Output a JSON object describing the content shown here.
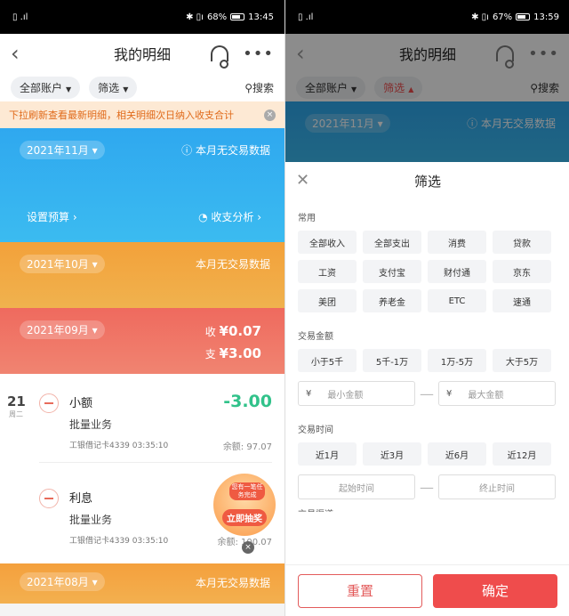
{
  "left": {
    "status": {
      "signal": "▯ .ıl",
      "icons": "✱ ▯ı",
      "battery": "68%",
      "time": "13:45"
    },
    "header": {
      "back": "‹",
      "title": "我的明细",
      "more": "•••"
    },
    "filters": {
      "account": "全部账户",
      "filter": "筛选",
      "search": "搜索"
    },
    "notice": {
      "text": "下拉刷新查看最新明细，相关明细次日纳入收支合计",
      "close": "×"
    },
    "months": {
      "nov": {
        "label": "2021年11月",
        "note": "本月无交易数据",
        "budget": "设置预算 ›",
        "analysis": "收支分析 ›"
      },
      "oct": {
        "label": "2021年10月",
        "note": "本月无交易数据"
      },
      "sep": {
        "label": "2021年09月",
        "in_label": "收",
        "in_amount": "¥0.07",
        "out_label": "支",
        "out_amount": "¥3.00"
      },
      "aug": {
        "label": "2021年08月",
        "note": "本月无交易数据"
      }
    },
    "day": {
      "date": "21",
      "weekday": "周二"
    },
    "transactions": [
      {
        "name": "小额",
        "type": "批量业务",
        "card": "工银借记卡4339  03:35:10",
        "amount": "-3.00",
        "balance": "余额: 97.07"
      },
      {
        "name": "利息",
        "type": "批量业务",
        "card": "工银借记卡4339  03:35:10",
        "amount": "",
        "balance": "余额: 100.07"
      }
    ],
    "promo": {
      "line1": "您有一笔任务完成",
      "line2": "立即抽奖",
      "close": "×"
    }
  },
  "right": {
    "status": {
      "battery": "67%",
      "time": "13:59"
    },
    "header": {
      "title": "我的明细"
    },
    "filters": {
      "account": "全部账户",
      "filter": "筛选",
      "search": "搜索"
    },
    "month": {
      "label": "2021年11月",
      "note": "本月无交易数据"
    },
    "sheet": {
      "title": "筛选",
      "close": "✕",
      "common_title": "常用",
      "common": [
        "全部收入",
        "全部支出",
        "消费",
        "贷款",
        "工资",
        "支付宝",
        "财付通",
        "京东",
        "美团",
        "养老金",
        "ETC",
        "速通"
      ],
      "amount_title": "交易金额",
      "amounts": [
        "小于5千",
        "5千-1万",
        "1万-5万",
        "大于5万"
      ],
      "min_placeholder": "最小金额",
      "max_placeholder": "最大金额",
      "currency": "¥",
      "time_title": "交易时间",
      "times": [
        "近1月",
        "近3月",
        "近6月",
        "近12月"
      ],
      "start_placeholder": "起始时间",
      "end_placeholder": "终止时间",
      "dash": "—",
      "next_title": "交易渠道"
    },
    "buttons": {
      "reset": "重置",
      "confirm": "确定"
    }
  },
  "colors": {
    "accent": "#ef4c4c",
    "green": "#31c28a",
    "nov": "#2fa8ef",
    "oct": "#f3a13a",
    "sep": "#ef6a5e"
  }
}
